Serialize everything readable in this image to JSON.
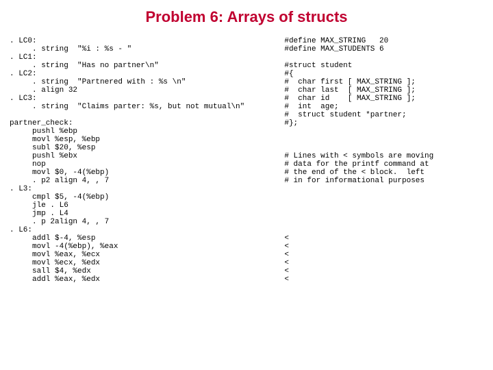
{
  "title": "Problem 6: Arrays of structs",
  "left": ". LC0:\n     . string  \"%i : %s - \"\n. LC1:\n     . string  \"Has no partner\\n\"\n. LC2:\n     . string  \"Partnered with : %s \\n\"\n     . align 32\n. LC3:\n     . string  \"Claims parter: %s, but not mutual\\n\"\n\npartner_check:\n     pushl %ebp\n     movl %esp, %ebp\n     subl $20, %esp\n     pushl %ebx\n     nop\n     movl $0, -4(%ebp)\n     . p2 align 4, , 7\n. L3:\n     cmpl $5, -4(%ebp)\n     jle . L6\n     jmp . L4\n     . p 2align 4, , 7\n. L6:\n     addl $-4, %esp\n     movl -4(%ebp), %eax\n     movl %eax, %ecx\n     movl %ecx, %edx\n     sall $4, %edx\n     addl %eax, %edx",
  "right": "#define MAX_STRING   20\n#define MAX_STUDENTS 6\n\n#struct student\n#{\n#  char first [ MAX_STRING ];\n#  char last  [ MAX_STRING ];\n#  char id    [ MAX_STRING ];\n#  int  age;\n#  struct student *partner;\n#};\n\n\n\n# Lines with < symbols are moving\n# data for the printf command at\n# the end of the < block.  left\n# in for informational purposes\n\n\n\n\n\n\n<\n<\n<\n<\n<\n<"
}
